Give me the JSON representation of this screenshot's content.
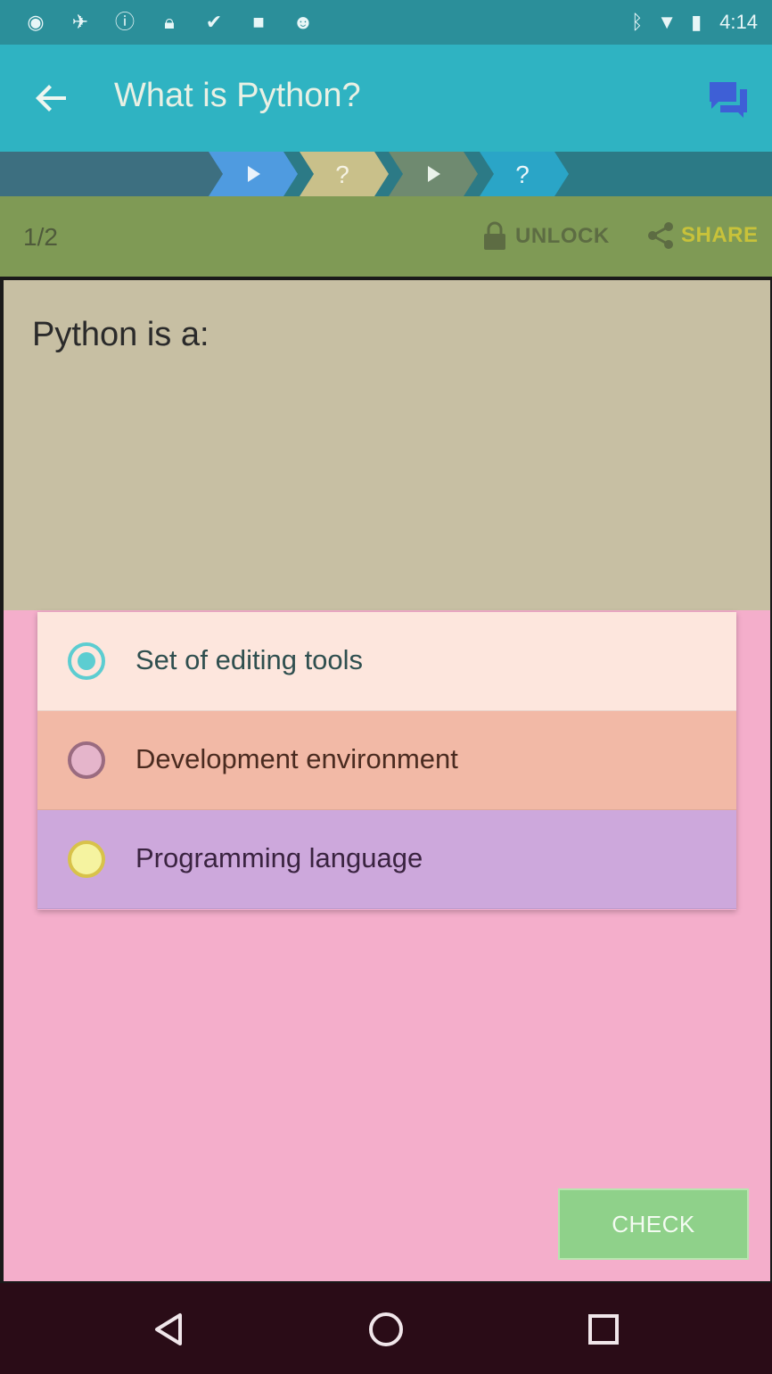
{
  "status_bar": {
    "icons": [
      "record-icon",
      "fake-gps-icon",
      "info-icon",
      "lock-icon",
      "briefcase-check-icon",
      "briefcase-icon",
      "android-icon"
    ],
    "right_icons": [
      "bluetooth-icon",
      "wifi-icon",
      "battery-icon"
    ],
    "time": "4:14"
  },
  "app_bar": {
    "title": "What is Python?",
    "back_icon": "arrow-back-icon",
    "chat_icon": "chat-bubbles-icon"
  },
  "steps": [
    {
      "type": "play",
      "color": "#4f9be0",
      "glyph": "▶"
    },
    {
      "type": "question",
      "color": "#c9c08a",
      "glyph": "?"
    },
    {
      "type": "play",
      "color": "#6f8a70",
      "glyph": "▶"
    },
    {
      "type": "question",
      "color": "#2aa5c7",
      "glyph": "?"
    }
  ],
  "meta": {
    "counter": "1/2",
    "unlock_label": "UNLOCK",
    "share_label": "SHARE"
  },
  "question": {
    "text": "Python is a:"
  },
  "options": [
    {
      "label": "Set of editing tools",
      "selected": true
    },
    {
      "label": "Development environment",
      "selected": false
    },
    {
      "label": "Programming language",
      "selected": false
    }
  ],
  "check_label": "CHECK",
  "nav": {
    "back": "nav-back-icon",
    "home": "nav-home-icon",
    "recents": "nav-recents-icon"
  }
}
